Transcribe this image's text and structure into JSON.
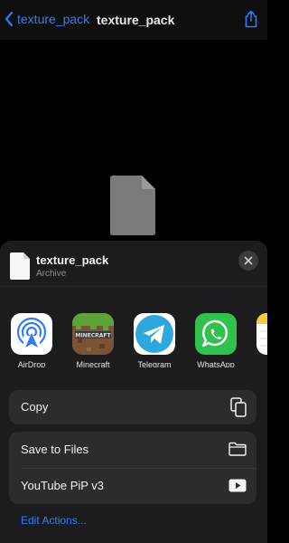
{
  "nav": {
    "back_label": "texture_pack",
    "title": "texture_pack"
  },
  "sheet": {
    "file_name": "texture_pack",
    "file_kind": "Archive",
    "apps": [
      {
        "label": "AirDrop"
      },
      {
        "label": "Minecraft"
      },
      {
        "label": "Telegram"
      },
      {
        "label": "WhatsApp"
      }
    ],
    "actions": {
      "copy": "Copy",
      "save_to_files": "Save to Files",
      "youtube_pip": "YouTube PiP v3"
    },
    "edit_actions": "Edit Actions..."
  },
  "colors": {
    "accent": "#2f7df6",
    "telegram": "#2ea6de",
    "whatsapp": "#30c14e",
    "sheet_bg": "#1c1c1e"
  }
}
